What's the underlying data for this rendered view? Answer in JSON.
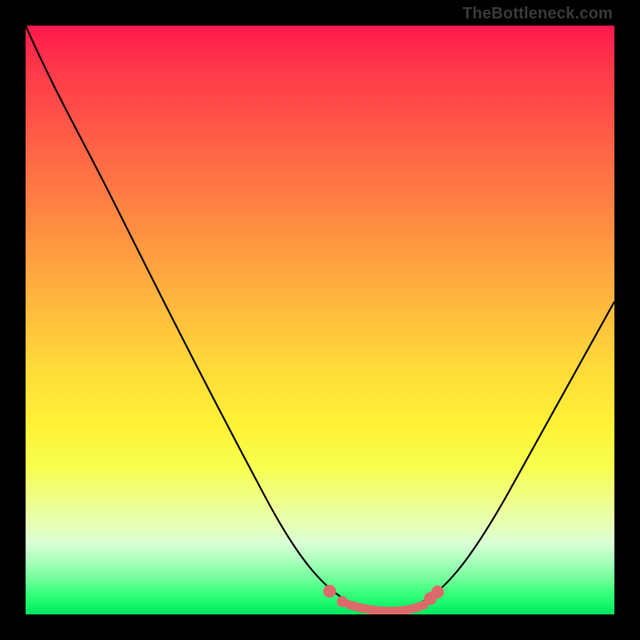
{
  "attribution": "TheBottleneck.com",
  "chart_data": {
    "type": "line",
    "title": "",
    "xlabel": "",
    "ylabel": "",
    "xlim": [
      0,
      100
    ],
    "ylim": [
      0,
      100
    ],
    "series": [
      {
        "name": "bottleneck-curve",
        "x": [
          0,
          10,
          20,
          30,
          40,
          48,
          52,
          55,
          58,
          62,
          66,
          70,
          80,
          90,
          100
        ],
        "y": [
          100,
          82,
          65,
          48,
          31,
          14,
          6,
          2,
          1,
          1,
          2,
          6,
          22,
          40,
          58
        ],
        "color": "#000000"
      },
      {
        "name": "flat-highlight",
        "x": [
          52,
          55,
          58,
          62,
          66
        ],
        "y": [
          6,
          2,
          1,
          1,
          2
        ],
        "color": "#dd6a6a"
      }
    ],
    "annotations": []
  },
  "colors": {
    "frame": "#000000",
    "highlight_stroke": "#dd6a6a",
    "curve_stroke": "#000000"
  }
}
